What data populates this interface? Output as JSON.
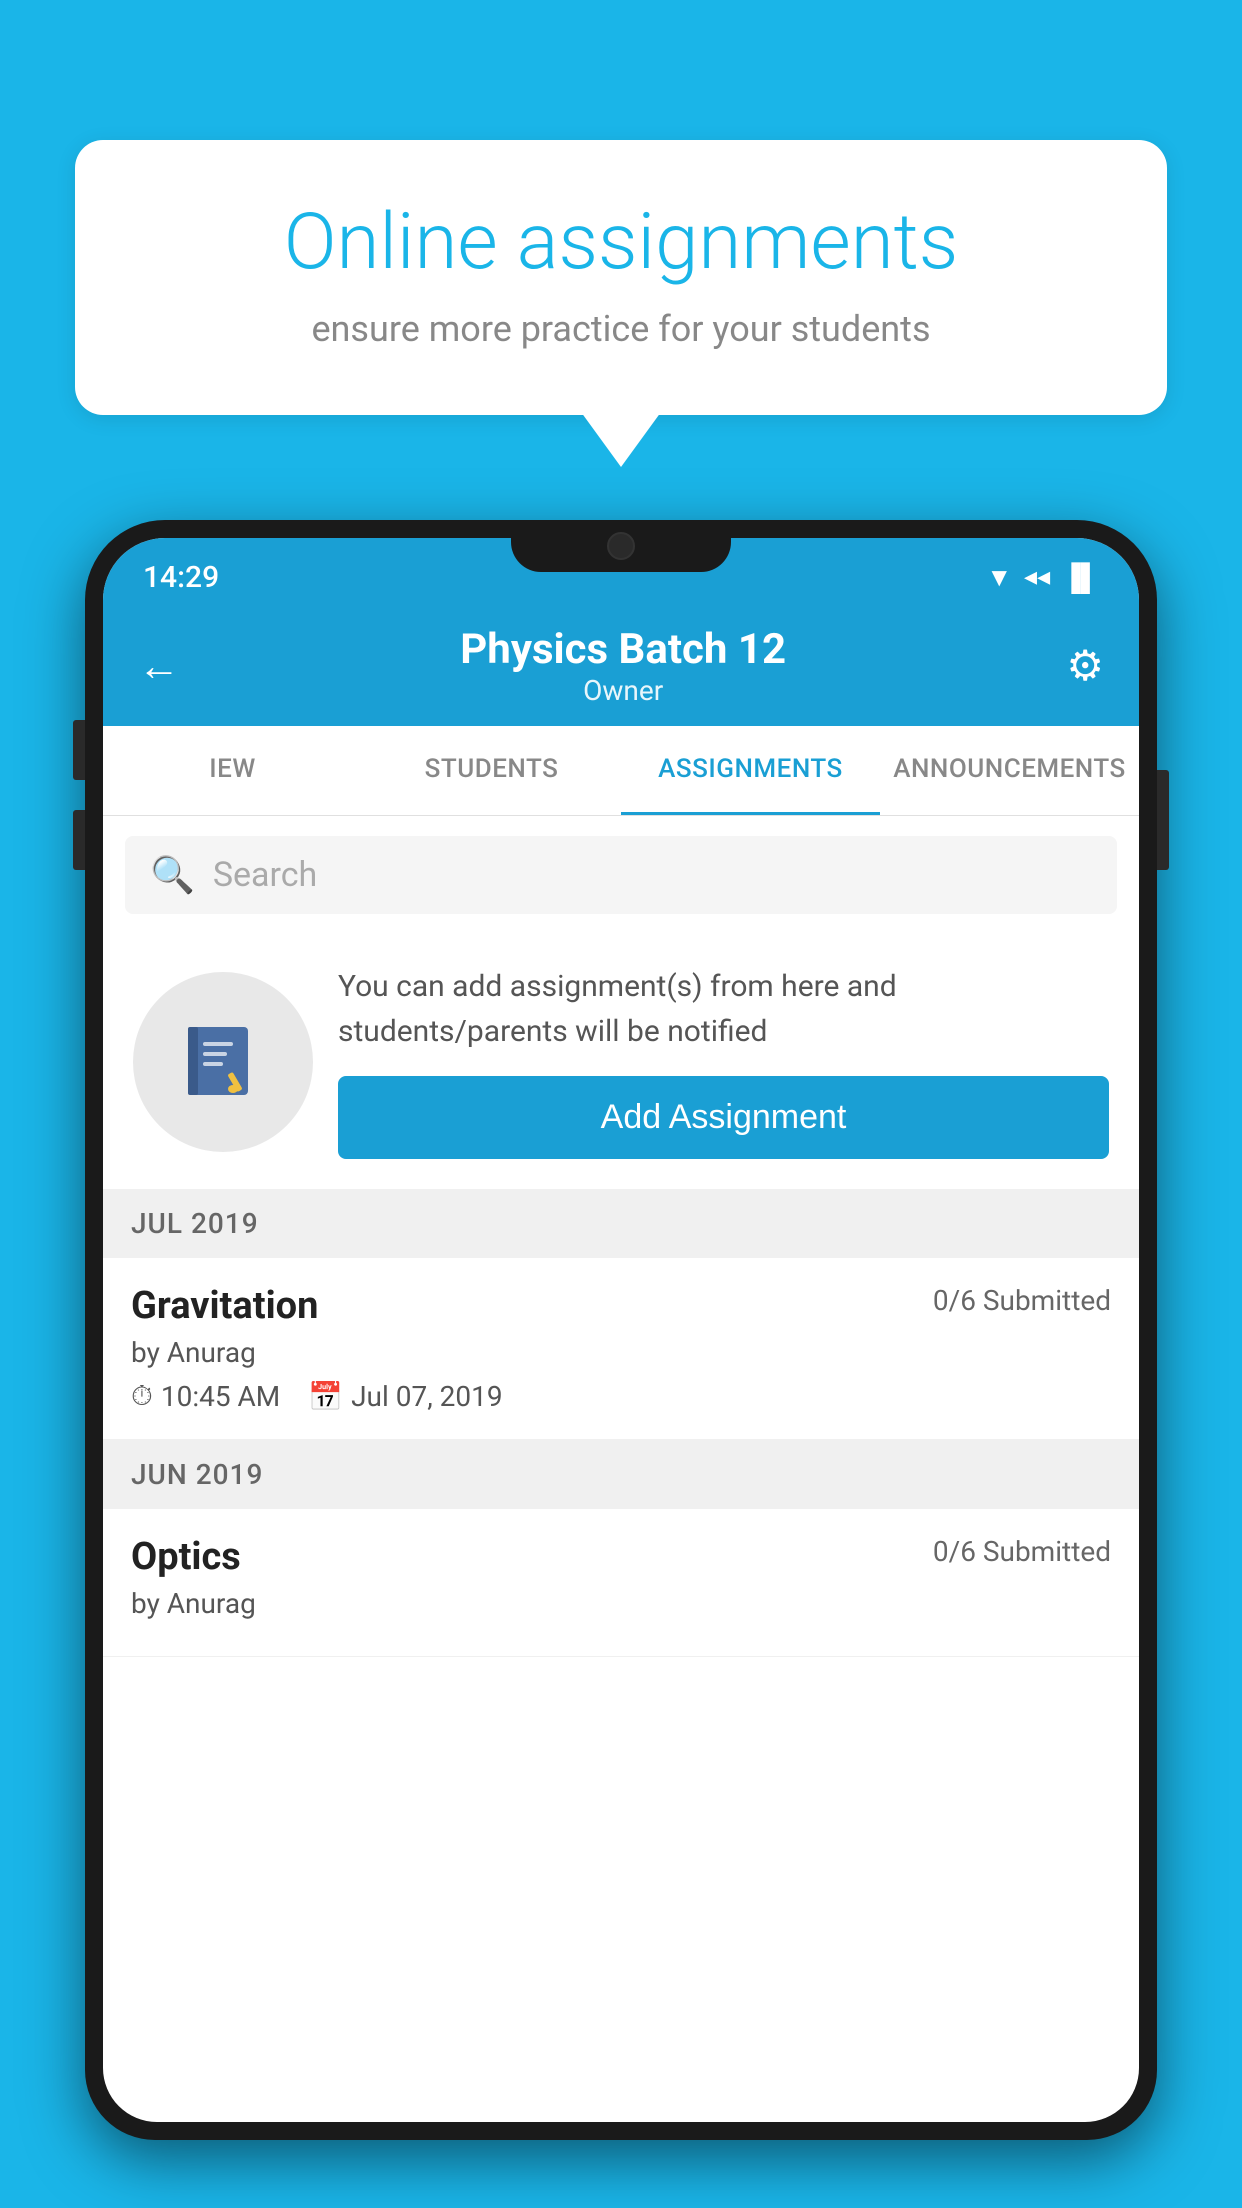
{
  "background_color": "#1ab5e8",
  "speech_bubble": {
    "title": "Online assignments",
    "subtitle": "ensure more practice for your students"
  },
  "status_bar": {
    "time": "14:29",
    "wifi": "▼",
    "signal": "▲",
    "battery": "▪"
  },
  "header": {
    "title": "Physics Batch 12",
    "subtitle": "Owner",
    "back_label": "←",
    "settings_label": "⚙"
  },
  "tabs": [
    {
      "label": "IEW",
      "active": false
    },
    {
      "label": "STUDENTS",
      "active": false
    },
    {
      "label": "ASSIGNMENTS",
      "active": true
    },
    {
      "label": "ANNOUNCEMENTS",
      "active": false
    }
  ],
  "search": {
    "placeholder": "Search"
  },
  "info_section": {
    "description": "You can add assignment(s) from here and students/parents will be notified",
    "button_label": "Add Assignment"
  },
  "sections": [
    {
      "month": "JUL 2019",
      "assignments": [
        {
          "name": "Gravitation",
          "status": "0/6 Submitted",
          "by": "by Anurag",
          "time": "10:45 AM",
          "date": "Jul 07, 2019"
        }
      ]
    },
    {
      "month": "JUN 2019",
      "assignments": [
        {
          "name": "Optics",
          "status": "0/6 Submitted",
          "by": "by Anurag",
          "time": "",
          "date": ""
        }
      ]
    }
  ]
}
